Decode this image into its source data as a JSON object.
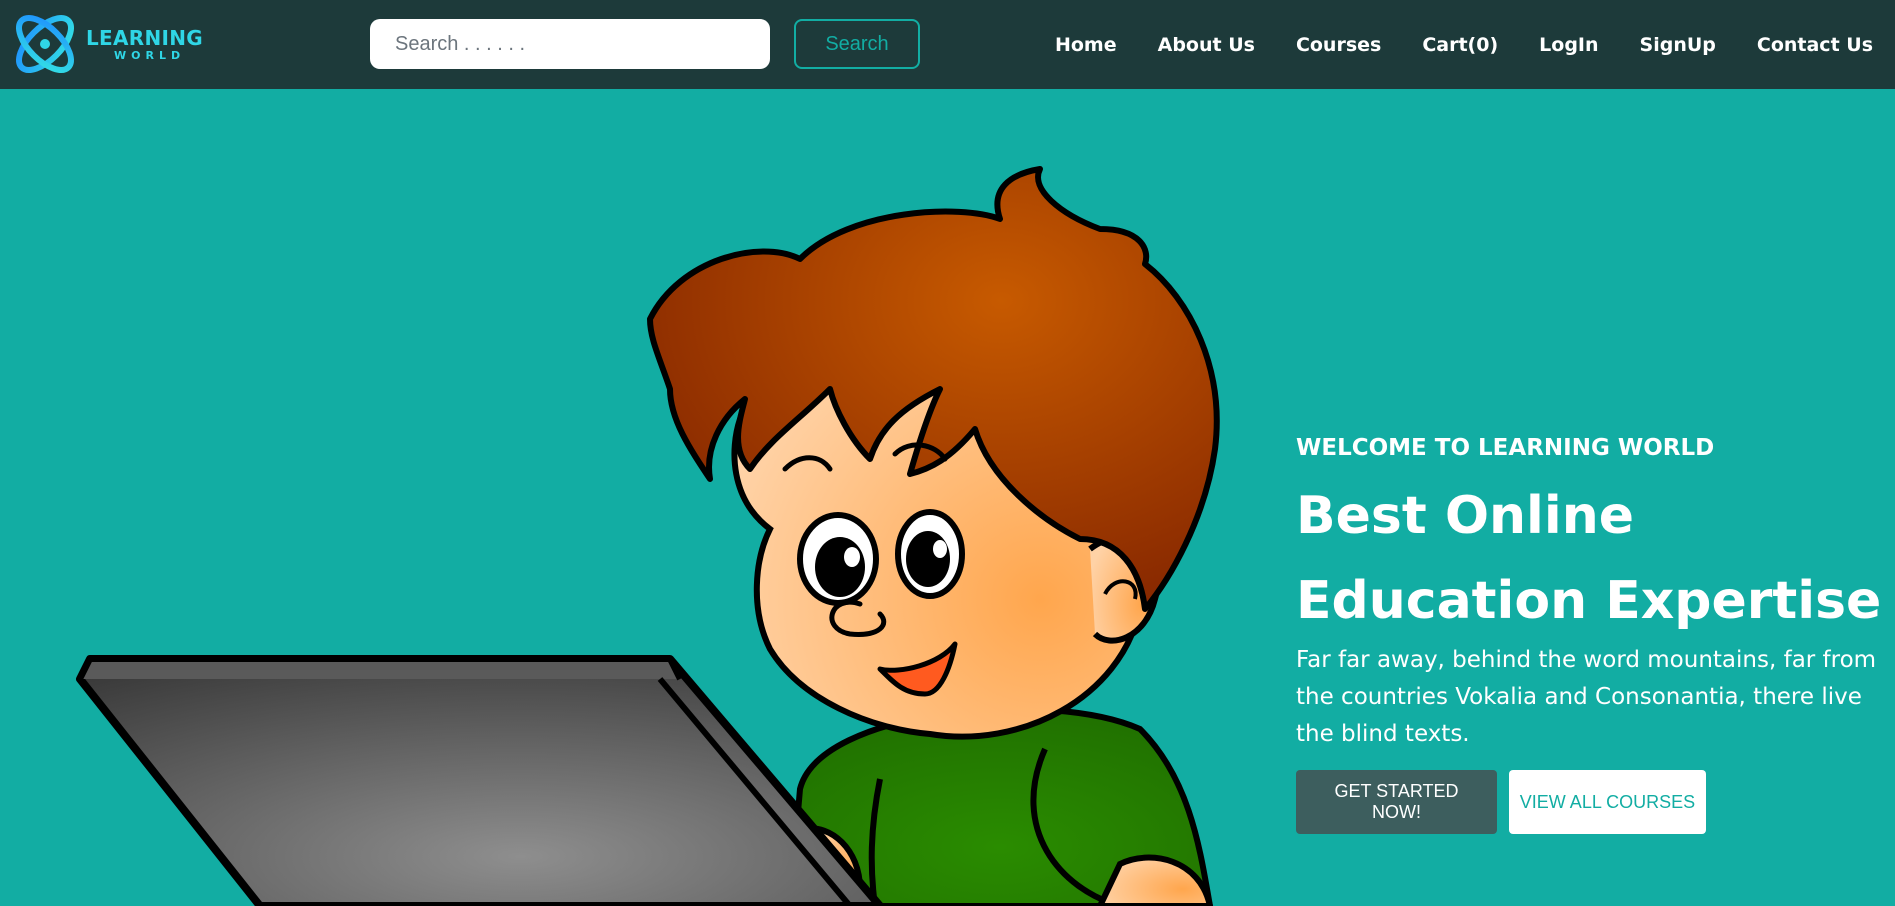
{
  "brand": {
    "title": "LEARNING",
    "subtitle": "WORLD",
    "accent_color": "#2fd6e6",
    "logo_icon": "atom-orbit-icon"
  },
  "search": {
    "placeholder": "Search . . . . . .",
    "value": "",
    "button_label": "Search"
  },
  "nav": {
    "items": [
      {
        "label": "Home"
      },
      {
        "label": "About Us"
      },
      {
        "label": "Courses"
      },
      {
        "label": "Cart(0)"
      },
      {
        "label": "LogIn"
      },
      {
        "label": "SignUp"
      },
      {
        "label": "Contact Us"
      }
    ]
  },
  "hero": {
    "welcome": "WELCOME TO LEARNING WORLD",
    "headline": "Best Online Education Expertise",
    "description": "Far far away, behind the word mountains, far from the countries Vokalia and Consonantia, there live the blind texts.",
    "primary_cta": "GET STARTED NOW!",
    "secondary_cta": "VIEW ALL COURSES",
    "background_color": "#12ada3",
    "illustration": "cartoon-boy-with-laptop"
  },
  "colors": {
    "navbar": "#1d3a3a",
    "hero_bg": "#12ada3",
    "primary_button": "#3d5e5e",
    "secondary_button": "#ffffff"
  }
}
